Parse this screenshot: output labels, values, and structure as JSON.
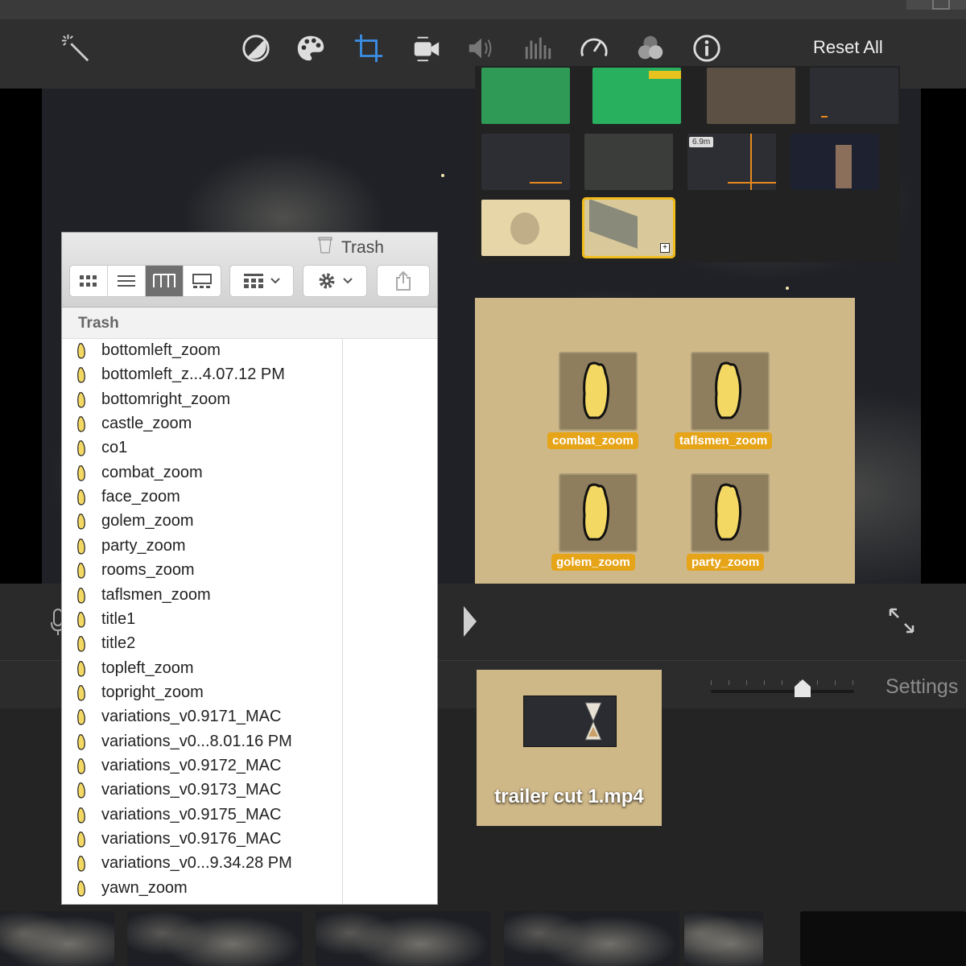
{
  "toolbar": {
    "icons": [
      "magic-wand-icon",
      "color-balance-icon",
      "color-palette-icon",
      "crop-icon",
      "camera-stabilization-icon",
      "volume-icon",
      "equalizer-icon",
      "speed-icon",
      "filters-icon",
      "info-icon"
    ],
    "reset_label": "Reset All",
    "active_color": "#3b8ee6"
  },
  "thumbnails": {
    "count": 10,
    "badge": "6.9m",
    "selected_index": 9,
    "selected_color": "#f2bd1c"
  },
  "finder": {
    "title": "Trash",
    "column_header": "Trash",
    "view_buttons": [
      "icon-view",
      "list-view",
      "column-view",
      "gallery-view"
    ],
    "active_view": "column-view",
    "items": [
      "bottomleft_zoom",
      "bottomleft_z...4.07.12 PM",
      "bottomright_zoom",
      "castle_zoom",
      "co1",
      "combat_zoom",
      "face_zoom",
      "golem_zoom",
      "party_zoom",
      "rooms_zoom",
      "taflsmen_zoom",
      "title1",
      "title2",
      "topleft_zoom",
      "topright_zoom",
      "variations_v0.9171_MAC",
      "variations_v0...8.01.16 PM",
      "variations_v0.9172_MAC",
      "variations_v0.9173_MAC",
      "variations_v0.9175_MAC",
      "variations_v0.9176_MAC",
      "variations_v0...9.34.28 PM",
      "yawn_zoom"
    ]
  },
  "desktop": {
    "icons": [
      {
        "label": "combat_zoom"
      },
      {
        "label": "taflsmen_zoom"
      },
      {
        "label": "golem_zoom"
      },
      {
        "label": "party_zoom"
      }
    ],
    "label_color": "#e6a419"
  },
  "trailer": {
    "label": "trailer cut 1.mp4"
  },
  "timeline": {
    "settings_label": "Settings"
  }
}
